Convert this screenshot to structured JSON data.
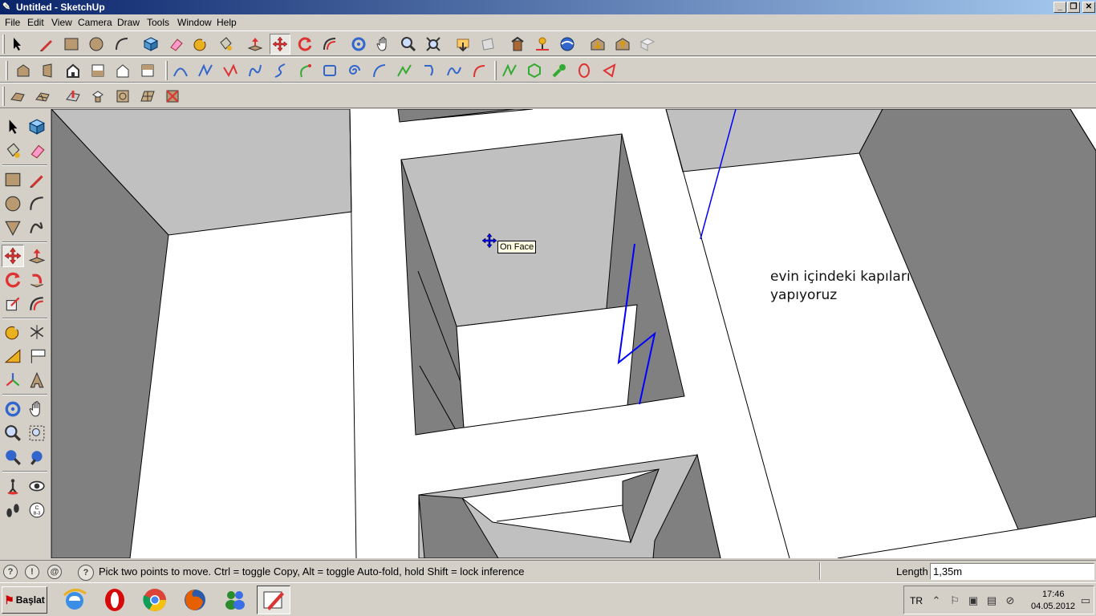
{
  "window": {
    "title": "Untitled - SketchUp",
    "app_icon": "sketchup-pencil-icon"
  },
  "menu": [
    "File",
    "Edit",
    "View",
    "Camera",
    "Draw",
    "Tools",
    "Window",
    "Help"
  ],
  "viewport": {
    "tooltip": "On Face",
    "annotation_line1": "evin içindeki kapıları",
    "annotation_line2": "yapıyoruz",
    "colors": {
      "face_light": "#c0c0c0",
      "face_dark": "#808080",
      "face_white": "#ffffff",
      "edge": "#000000",
      "axis_blue": "#0000ff"
    }
  },
  "status": {
    "message": "Pick two points to move.  Ctrl = toggle Copy, Alt = toggle Auto-fold, hold Shift = lock inference",
    "vcb_label": "Length",
    "vcb_value": "1,35m",
    "help_icon": "question-icon"
  },
  "taskbar": {
    "start_label": "Başlat",
    "apps": [
      "internet-explorer-icon",
      "opera-icon",
      "chrome-icon",
      "firefox-icon",
      "users-icon",
      "sketchup-icon"
    ],
    "active_app": "sketchup-icon",
    "language": "TR",
    "time": "17:46",
    "date": "04.05.2012"
  }
}
